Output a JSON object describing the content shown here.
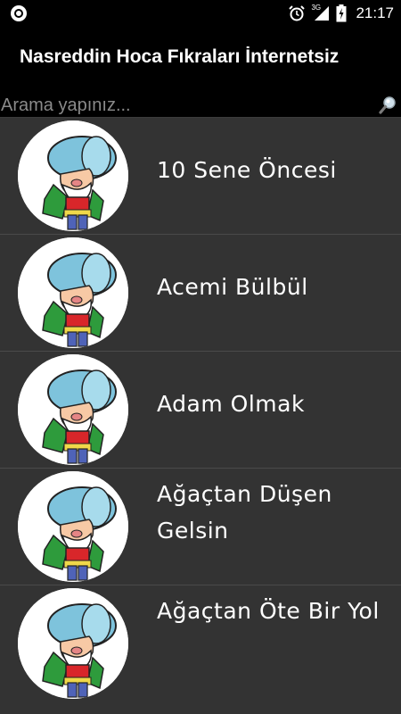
{
  "status_bar": {
    "network": "3G",
    "time": "21:17"
  },
  "app": {
    "title": "Nasreddin Hoca Fıkraları İnternetsiz"
  },
  "search": {
    "placeholder": "Arama yapınız..."
  },
  "items": [
    {
      "title": "10 Sene Öncesi"
    },
    {
      "title": "Acemi Bülbül"
    },
    {
      "title": "Adam Olmak"
    },
    {
      "title": "Ağaçtan Düşen Gelsin"
    },
    {
      "title": "Ağaçtan Öte Bir Yol"
    }
  ],
  "icons": {
    "status_left": "circle-notification-icon",
    "alarm": "alarm-clock-icon",
    "signal": "signal-icon",
    "battery": "battery-charging-icon",
    "search": "search-icon",
    "avatar": "nasreddin-hoca-avatar-icon"
  }
}
